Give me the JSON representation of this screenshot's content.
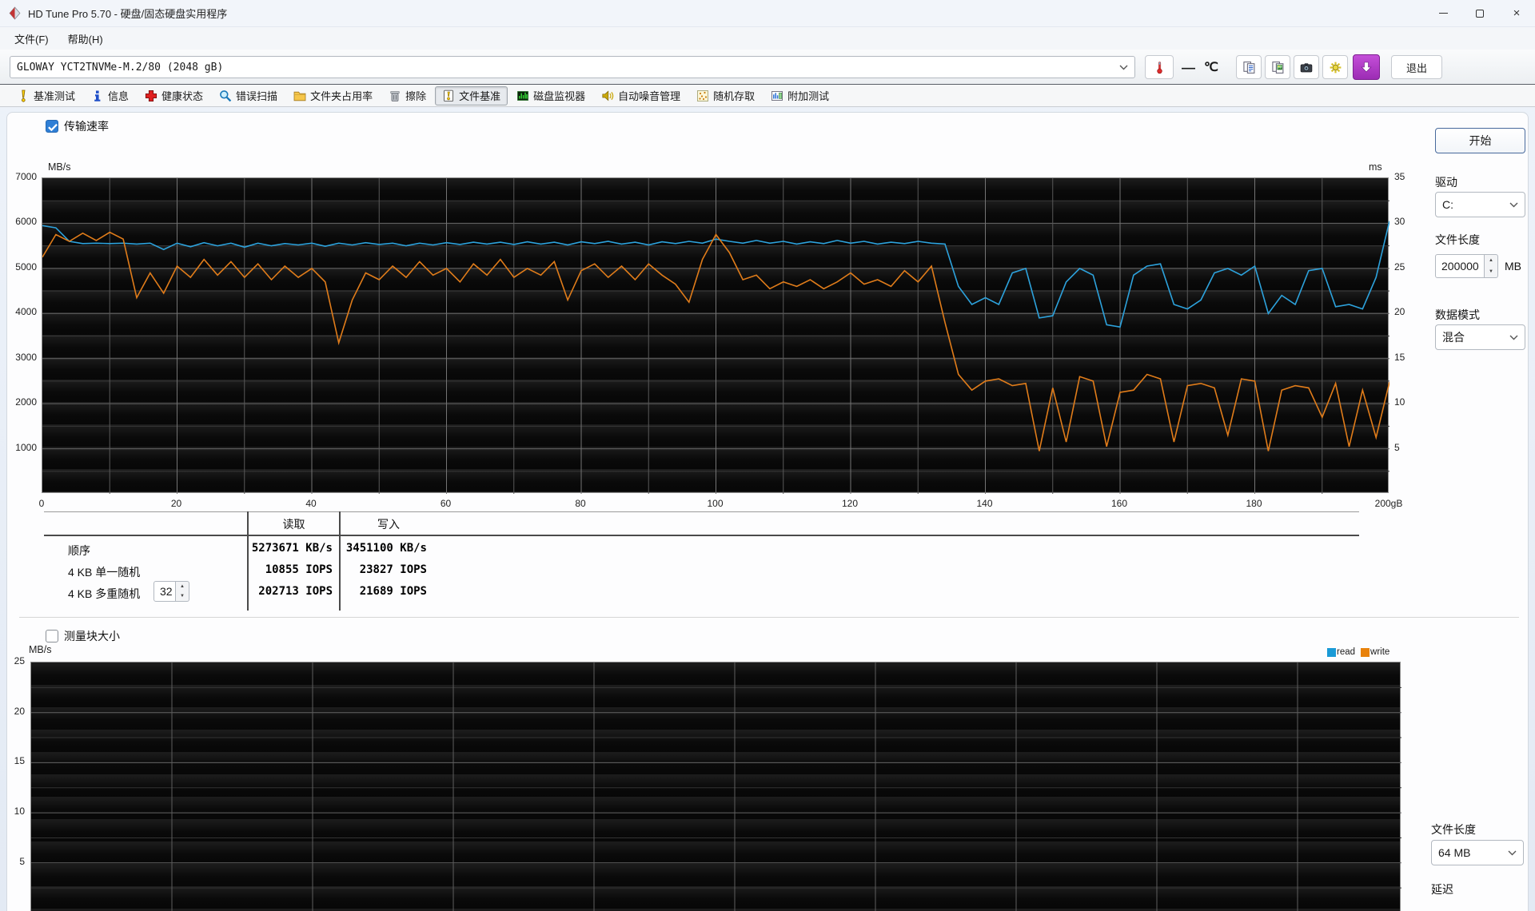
{
  "window": {
    "title": "HD Tune Pro 5.70 - 硬盘/固态硬盘实用程序",
    "controls": {
      "minimize": "minimize",
      "maximize": "maximize",
      "close": "close"
    }
  },
  "menu": {
    "file": "文件(F)",
    "help": "帮助(H)"
  },
  "drive_bar": {
    "drive_selected": "GLOWAY YCT2TNVMe-M.2/80 (2048 gB)",
    "temperature_value": "—",
    "temperature_unit": "℃",
    "exit_label": "退出",
    "icon_buttons": [
      "thermometer-icon",
      "copy-text-icon",
      "copy-image-icon",
      "camera-icon",
      "options-icon",
      "download-arrow-icon"
    ]
  },
  "toolbar": {
    "active_tab": "文件基准",
    "tabs": [
      {
        "label": "基准测试",
        "icon": "benchmark-icon"
      },
      {
        "label": "信息",
        "icon": "info-icon"
      },
      {
        "label": "健康状态",
        "icon": "health-icon"
      },
      {
        "label": "错误扫描",
        "icon": "error-scan-icon"
      },
      {
        "label": "文件夹占用率",
        "icon": "folder-usage-icon"
      },
      {
        "label": "擦除",
        "icon": "erase-icon"
      },
      {
        "label": "文件基准",
        "icon": "file-benchmark-icon"
      },
      {
        "label": "磁盘监视器",
        "icon": "disk-monitor-icon"
      },
      {
        "label": "自动噪音管理",
        "icon": "aam-icon"
      },
      {
        "label": "随机存取",
        "icon": "random-access-icon"
      },
      {
        "label": "附加测试",
        "icon": "extra-tests-icon"
      }
    ]
  },
  "file_benchmark": {
    "transfer_rate_label": "传输速率",
    "start_button": "开始",
    "drive_label": "驱动",
    "drive_value": "C:",
    "file_length_label": "文件长度",
    "file_length_value": "200000",
    "file_length_unit": "MB",
    "data_mode_label": "数据模式",
    "data_mode_value": "混合",
    "results": {
      "col_read": "读取",
      "col_write": "写入",
      "rows": [
        {
          "label": "顺序",
          "read": "5273671 KB/s",
          "write": "3451100 KB/s"
        },
        {
          "label": "4 KB 单一随机",
          "read": "10855 IOPS",
          "write": "23827 IOPS"
        },
        {
          "label": "4 KB 多重随机",
          "queue_depth": "32",
          "read": "202713 IOPS",
          "write": "21689 IOPS"
        }
      ]
    },
    "block_size_label": "测量块大小",
    "legend": {
      "read": "read",
      "write": "write"
    },
    "file_length2_label": "文件长度",
    "file_length2_value": "64 MB",
    "latency_label": "延迟"
  },
  "chart_data": [
    {
      "type": "line",
      "title": "传输速率 (transfer rate over disk position)",
      "xlabel": "gB",
      "xlim": [
        0,
        200
      ],
      "x_tick_labels": [
        "0",
        "20",
        "40",
        "60",
        "80",
        "100",
        "120",
        "140",
        "160",
        "180",
        "200gB"
      ],
      "ylabel_left": "MB/s",
      "ylim_left": [
        0,
        7000
      ],
      "yticks_left": [
        "7000",
        "6000",
        "5000",
        "4000",
        "3000",
        "2000",
        "1000"
      ],
      "ylabel_right": "ms",
      "ylim_right": [
        0,
        35
      ],
      "yticks_right": [
        "35",
        "30",
        "25",
        "20",
        "15",
        "10",
        "5"
      ],
      "grid": {
        "x_minor_step": 10,
        "y_minor_step": 500,
        "y_major_step": 1000
      },
      "series": [
        {
          "name": "read",
          "color": "#2da2dc",
          "x_step": 2,
          "values": [
            5950,
            5900,
            5600,
            5550,
            5560,
            5550,
            5560,
            5540,
            5560,
            5420,
            5560,
            5480,
            5570,
            5500,
            5560,
            5470,
            5560,
            5500,
            5550,
            5520,
            5560,
            5490,
            5560,
            5520,
            5570,
            5530,
            5560,
            5500,
            5560,
            5520,
            5570,
            5530,
            5580,
            5540,
            5580,
            5530,
            5590,
            5540,
            5580,
            5520,
            5590,
            5550,
            5600,
            5540,
            5580,
            5520,
            5590,
            5550,
            5600,
            5560,
            5650,
            5600,
            5560,
            5620,
            5560,
            5600,
            5540,
            5590,
            5550,
            5620,
            5560,
            5600,
            5540,
            5580,
            5550,
            5600,
            5560,
            5540,
            4600,
            4200,
            4350,
            4200,
            4900,
            5000,
            3900,
            3950,
            4700,
            5000,
            4850,
            3750,
            3700,
            4850,
            5050,
            5100,
            4200,
            4100,
            4300,
            4900,
            5000,
            4850,
            5050,
            4000,
            4400,
            4200,
            4950,
            5000,
            4150,
            4200,
            4100,
            4800,
            6050
          ]
        },
        {
          "name": "write",
          "color": "#e07c1a",
          "x_step": 2,
          "values": [
            5250,
            5750,
            5600,
            5780,
            5620,
            5800,
            5650,
            4350,
            4900,
            4450,
            5050,
            4800,
            5200,
            4850,
            5150,
            4800,
            5100,
            4750,
            5050,
            4800,
            5000,
            4700,
            3350,
            4300,
            4900,
            4750,
            5050,
            4800,
            5150,
            4850,
            5000,
            4700,
            5100,
            4850,
            5200,
            4800,
            5000,
            4850,
            5150,
            4300,
            4950,
            5100,
            4800,
            5050,
            4750,
            5100,
            4850,
            4650,
            4250,
            5200,
            5750,
            5350,
            4750,
            4850,
            4550,
            4700,
            4600,
            4750,
            4550,
            4700,
            4900,
            4650,
            4750,
            4600,
            4950,
            4700,
            5050,
            3800,
            2650,
            2300,
            2500,
            2550,
            2400,
            2450,
            950,
            2350,
            1150,
            2600,
            2500,
            1050,
            2250,
            2300,
            2650,
            2550,
            1150,
            2400,
            2450,
            2350,
            1300,
            2550,
            2500,
            950,
            2300,
            2400,
            2350,
            1700,
            2450,
            1050,
            2300,
            1250,
            2480
          ]
        }
      ]
    },
    {
      "type": "line",
      "title": "测量块大小 (transfer rate vs block size — no data)",
      "ylabel_left": "MB/s",
      "ylim_left": [
        0,
        25
      ],
      "yticks_left": [
        "25",
        "20",
        "15",
        "10",
        "5"
      ],
      "legend_entries": [
        "read",
        "write"
      ],
      "legend_colors": [
        "#1a9ad6",
        "#e8820c"
      ],
      "series": []
    }
  ]
}
